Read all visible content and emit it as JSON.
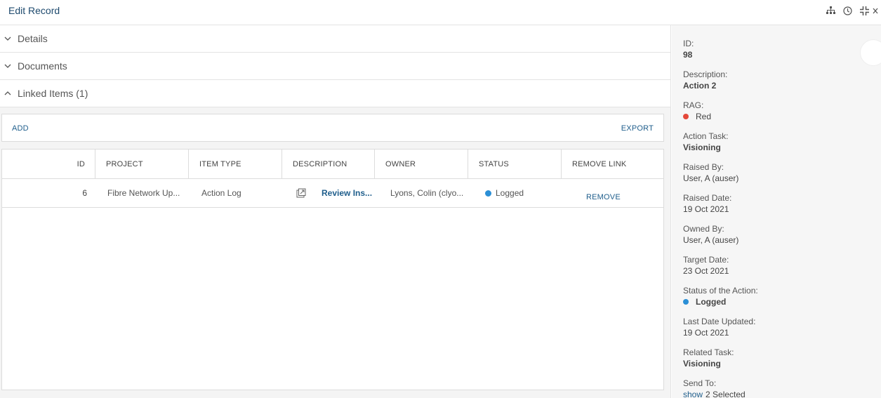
{
  "header": {
    "title": "Edit Record",
    "icons": [
      "hierarchy-icon",
      "history-icon",
      "collapse-icon",
      "close-icon"
    ]
  },
  "sections": [
    {
      "label": "Details",
      "state": "collapsed"
    },
    {
      "label": "Documents",
      "state": "collapsed"
    },
    {
      "label": "Linked Items (1)",
      "state": "expanded"
    }
  ],
  "toolbar": {
    "add_label": "ADD",
    "export_label": "EXPORT"
  },
  "table": {
    "columns": [
      "ID",
      "PROJECT",
      "ITEM TYPE",
      "DESCRIPTION",
      "OWNER",
      "STATUS",
      "REMOVE LINK"
    ],
    "rows": [
      {
        "id": "6",
        "project": "Fibre Network Up...",
        "item_type": "Action Log",
        "description": "Review Ins...",
        "owner": "Lyons, Colin (clyo...",
        "status": "Logged",
        "status_color": "#2b8fd6",
        "remove_label": "REMOVE"
      }
    ]
  },
  "details": {
    "id_label": "ID:",
    "id_value": "98",
    "description_label": "Description:",
    "description_value": "Action 2",
    "rag_label": "RAG:",
    "rag_value": "Red",
    "rag_color": "#e4483a",
    "action_task_label": "Action Task:",
    "action_task_value": "Visioning",
    "raised_by_label": "Raised By:",
    "raised_by_value": "User, A (auser)",
    "raised_date_label": "Raised Date:",
    "raised_date_value": "19 Oct 2021",
    "owned_by_label": "Owned By:",
    "owned_by_value": "User, A (auser)",
    "target_date_label": "Target Date:",
    "target_date_value": "23 Oct 2021",
    "status_label": "Status of the Action:",
    "status_value": "Logged",
    "status_color": "#2b8fd6",
    "last_updated_label": "Last Date Updated:",
    "last_updated_value": "19 Oct 2021",
    "related_task_label": "Related Task:",
    "related_task_value": "Visioning",
    "send_to_label": "Send To:",
    "send_to_link": "show",
    "send_to_value": "2 Selected"
  },
  "colors": {
    "accent": "#1f5e8c",
    "title": "#1e4a6e"
  }
}
